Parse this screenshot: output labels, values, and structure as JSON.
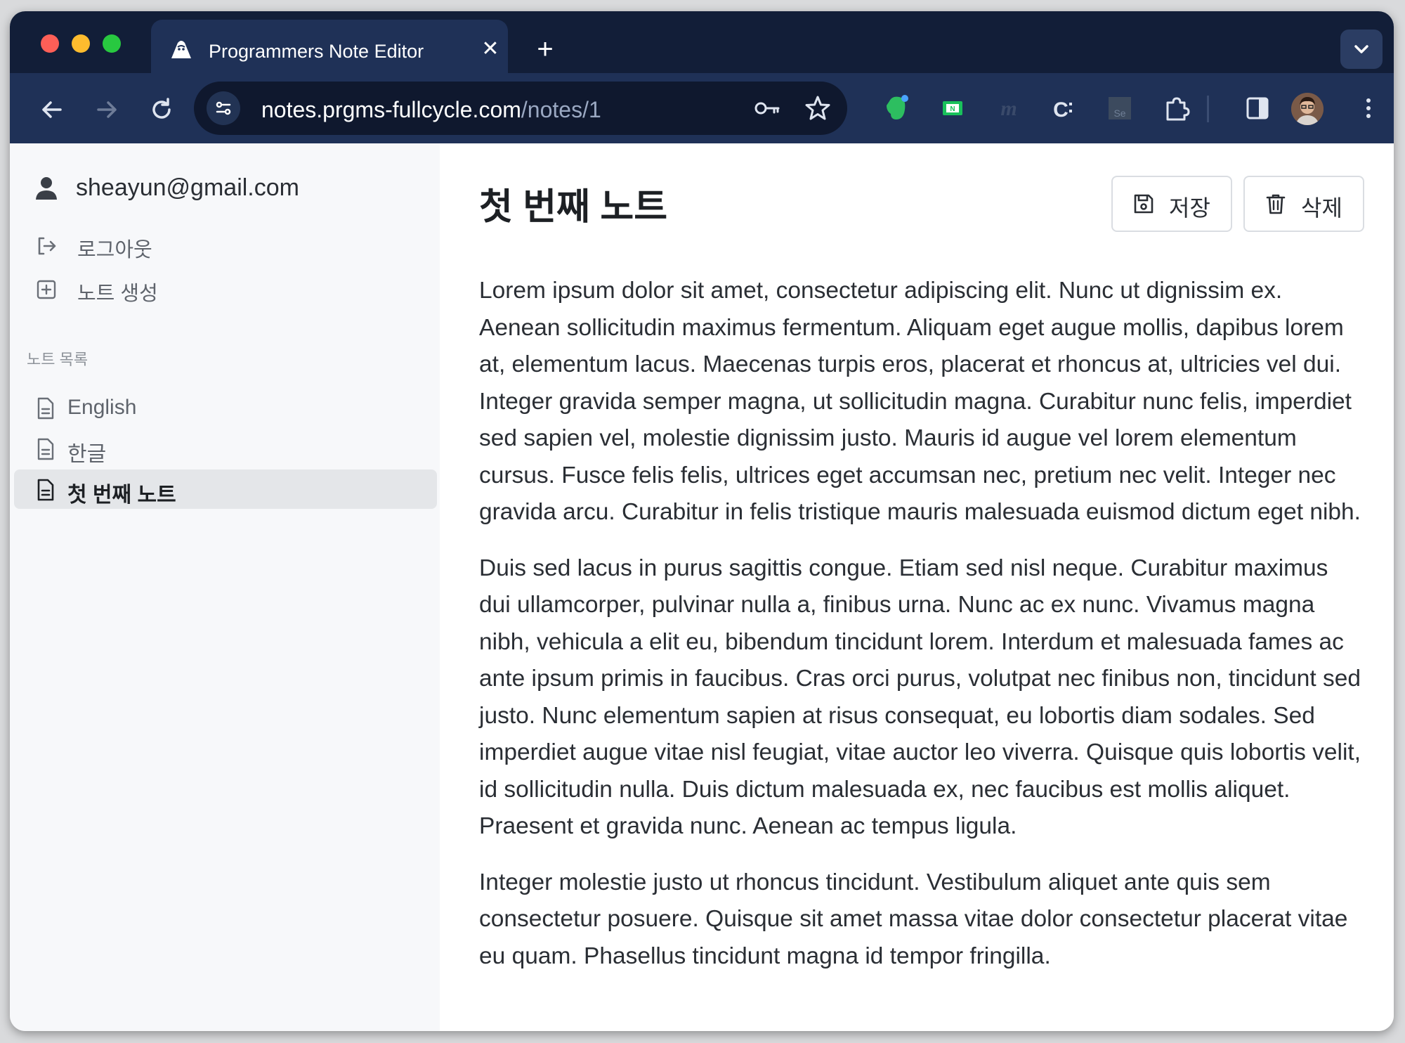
{
  "browser": {
    "tab_title": "Programmers Note Editor",
    "url_host": "notes.prgms-fullcycle.com",
    "url_path": "/notes/1",
    "colors": {
      "chrome": "#121e38",
      "toolbar": "#1f3157"
    }
  },
  "sidebar": {
    "user_email": "sheayun@gmail.com",
    "actions": [
      {
        "label": "로그아웃",
        "icon": "logout-icon"
      },
      {
        "label": "노트 생성",
        "icon": "plus-square-icon"
      }
    ],
    "section_label": "노트 목록",
    "notes": [
      {
        "label": "English",
        "active": false
      },
      {
        "label": "한글",
        "active": false
      },
      {
        "label": "첫 번째 노트",
        "active": true
      }
    ]
  },
  "note": {
    "title": "첫 번째 노트",
    "save_label": "저장",
    "delete_label": "삭제",
    "paragraphs": [
      "Lorem ipsum dolor sit amet, consectetur adipiscing elit. Nunc ut dignissim ex. Aenean sollicitudin maximus fermentum. Aliquam eget augue mollis, dapibus lorem at, elementum lacus. Maecenas turpis eros, placerat et rhoncus at, ultricies vel dui. Integer gravida semper magna, ut sollicitudin magna. Curabitur nunc felis, imperdiet sed sapien vel, molestie dignissim justo. Mauris id augue vel lorem elementum cursus. Fusce felis felis, ultrices eget accumsan nec, pretium nec velit. Integer nec gravida arcu. Curabitur in felis tristique mauris malesuada euismod dictum eget nibh.",
      "Duis sed lacus in purus sagittis congue. Etiam sed nisl neque. Curabitur maximus dui ullamcorper, pulvinar nulla a, finibus urna. Nunc ac ex nunc. Vivamus magna nibh, vehicula a elit eu, bibendum tincidunt lorem. Interdum et malesuada fames ac ante ipsum primis in faucibus. Cras orci purus, volutpat nec finibus non, tincidunt sed justo. Nunc elementum sapien at risus consequat, eu lobortis diam sodales. Sed imperdiet augue vitae nisl feugiat, vitae auctor leo viverra. Quisque quis lobortis velit, id sollicitudin nulla. Duis dictum malesuada ex, nec faucibus est mollis aliquet. Praesent et gravida nunc. Aenean ac tempus ligula.",
      "Integer molestie justo ut rhoncus tincidunt. Vestibulum aliquet ante quis sem consectetur posuere. Quisque sit amet massa vitae dolor consectetur placerat vitae eu quam. Phasellus tincidunt magna id tempor fringilla."
    ]
  }
}
